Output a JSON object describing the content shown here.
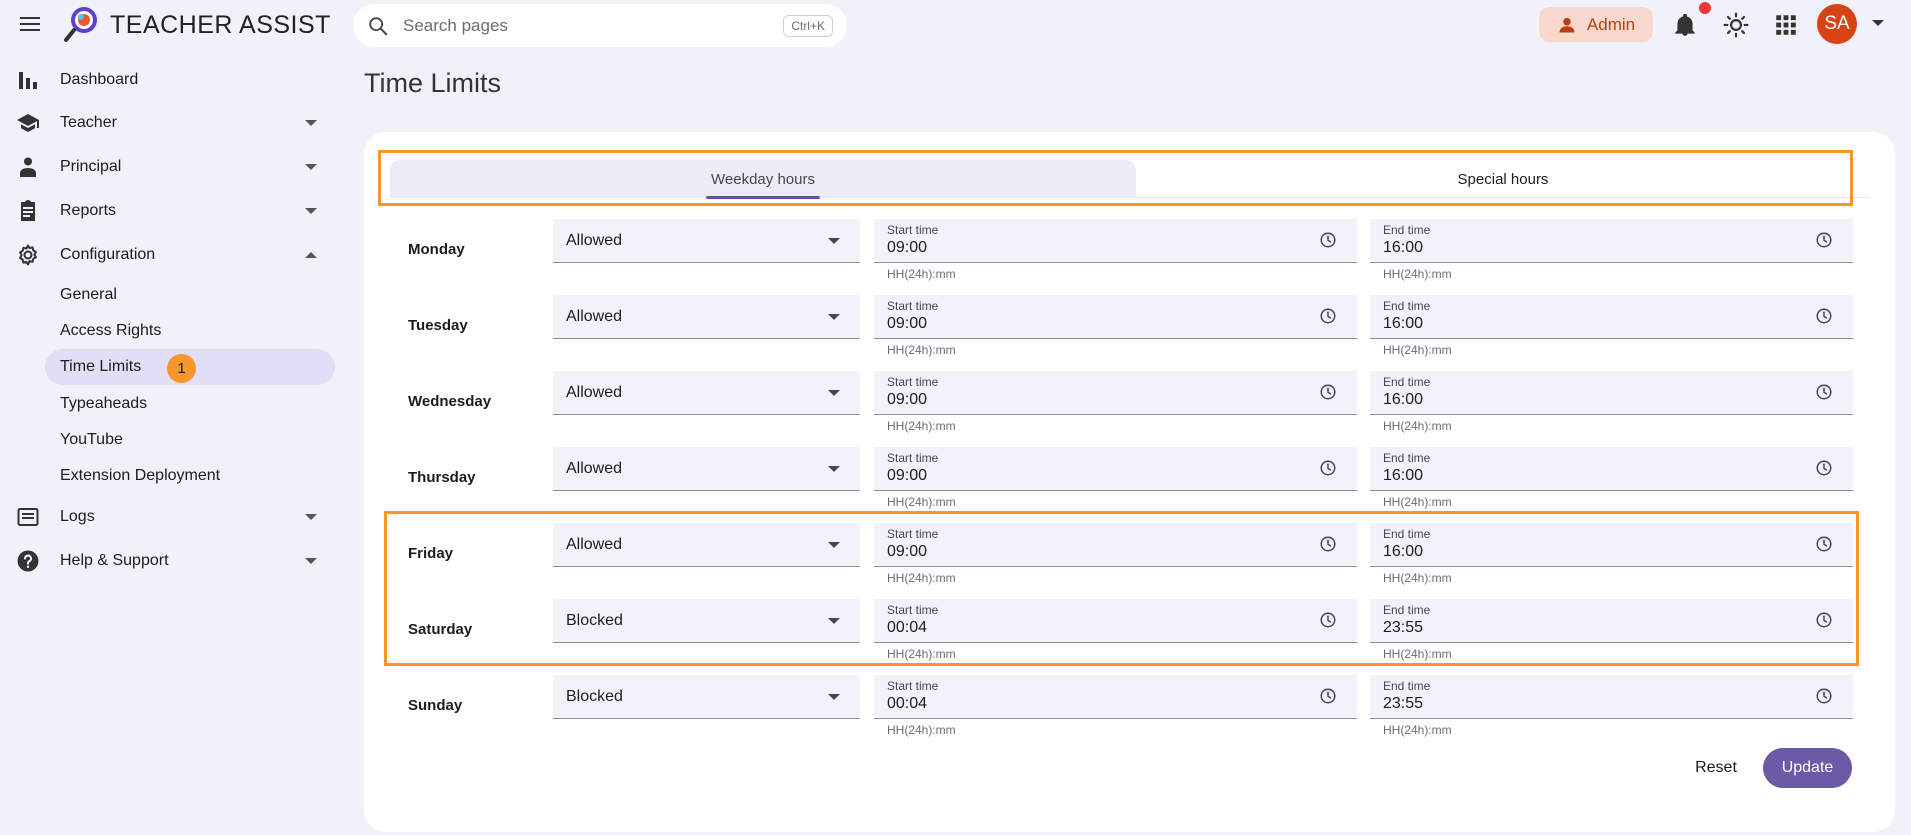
{
  "app": {
    "title": "TEACHER ASSIST"
  },
  "search": {
    "placeholder": "Search pages",
    "shortcut": "Ctrl+K"
  },
  "topbar": {
    "admin_label": "Admin",
    "avatar_initials": "SA",
    "accent": "#6750a4",
    "admin_color": "#b8420d",
    "avatar_color": "#d84315"
  },
  "sidebar": {
    "items": [
      {
        "label": "Dashboard",
        "icon": "bar-chart-icon"
      },
      {
        "label": "Teacher",
        "icon": "school-icon"
      },
      {
        "label": "Principal",
        "icon": "person-icon"
      },
      {
        "label": "Reports",
        "icon": "clipboard-icon"
      },
      {
        "label": "Configuration",
        "icon": "gear-icon"
      },
      {
        "label": "Logs",
        "icon": "list-icon"
      },
      {
        "label": "Help & Support",
        "icon": "help-icon"
      }
    ],
    "config_sub": [
      "General",
      "Access Rights",
      "Time Limits",
      "Typeaheads",
      "YouTube",
      "Extension Deployment"
    ],
    "active_badge": "1"
  },
  "page": {
    "title": "Time Limits"
  },
  "tabs": [
    "Weekday hours",
    "Special hours"
  ],
  "fields": {
    "start_label": "Start time",
    "end_label": "End time",
    "helper": "HH(24h):mm"
  },
  "days": [
    {
      "day": "Monday",
      "status": "Allowed",
      "start": "09:00",
      "end": "16:00"
    },
    {
      "day": "Tuesday",
      "status": "Allowed",
      "start": "09:00",
      "end": "16:00"
    },
    {
      "day": "Wednesday",
      "status": "Allowed",
      "start": "09:00",
      "end": "16:00"
    },
    {
      "day": "Thursday",
      "status": "Allowed",
      "start": "09:00",
      "end": "16:00"
    },
    {
      "day": "Friday",
      "status": "Allowed",
      "start": "09:00",
      "end": "16:00"
    },
    {
      "day": "Saturday",
      "status": "Blocked",
      "start": "00:04",
      "end": "23:55"
    },
    {
      "day": "Sunday",
      "status": "Blocked",
      "start": "00:04",
      "end": "23:55"
    }
  ],
  "actions": {
    "reset": "Reset",
    "update": "Update"
  }
}
